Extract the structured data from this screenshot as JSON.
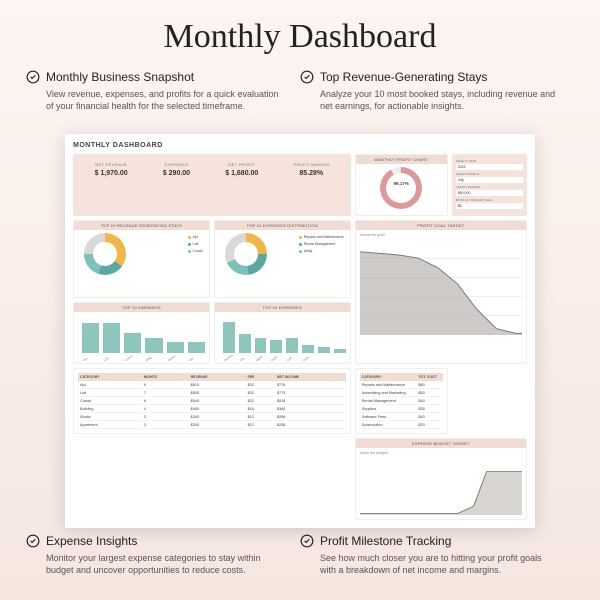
{
  "page_title": "Monthly Dashboard",
  "features_top": [
    {
      "title": "Monthly Business Snapshot",
      "desc": "View revenue, expenses, and profits for a quick evaluation of your financial health for the selected timeframe."
    },
    {
      "title": "Top Revenue-Generating Stays",
      "desc": "Analyze your 10 most booked stays, including revenue and net earnings, for actionable insights."
    }
  ],
  "features_bottom": [
    {
      "title": "Expense Insights",
      "desc": "Monitor your largest expense categories to stay within budget and uncover opportunities to reduce costs."
    },
    {
      "title": "Profit Milestone Tracking",
      "desc": "See how much closer you are to hitting your profit goals with a breakdown of net income and margins."
    }
  ],
  "dash": {
    "title": "MONTHLY DASHBOARD",
    "kpis": [
      {
        "label": "NET REVENUE",
        "value": "$ 1,970.00"
      },
      {
        "label": "EXPENSES",
        "value": "$ 290.00"
      },
      {
        "label": "NET PROFIT",
        "value": "$ 1,680.00"
      },
      {
        "label": "PROFIT MARGIN",
        "value": "85.28%"
      }
    ],
    "gross_profit_header": "MONTHLY PROFIT CHART",
    "gross_profit_value": "99.17%",
    "selectors": [
      {
        "label": "SELECT YEAR",
        "value": "2023"
      },
      {
        "label": "SELECT MONTH",
        "value": "July"
      },
      {
        "label": "YEARLY BUDGET",
        "value": "$50,000"
      },
      {
        "label": "MONTHLY BUDGET GOAL",
        "value": "$5"
      }
    ],
    "donutA_header": "TOP 10 REVENUE GENERATING STAYS",
    "donutA_legend": [
      "Apt",
      "Loft",
      "Condo"
    ],
    "donutB_header": "TOP 10 EXPENSES DISTRIBUTION",
    "donutB_legend": [
      "Repairs and Maintenance",
      "Rental Management",
      "Utility"
    ],
    "barsA_header": "TOP 10 EARNINGS",
    "barsB_header": "TOP 10 EXPENSES",
    "goal_header": "PROFIT GOAL TARGET",
    "goal_sub": "Almost the goal!",
    "budget_header": "EXPENSE BUDGET TARGET",
    "budget_sub": "Under the budget!",
    "table_headers": [
      "CATEGORY",
      "NIGHTS",
      "REVENUE",
      "FEE",
      "NET INCOME"
    ],
    "table_rows": [
      [
        "Apt",
        "9",
        "$810",
        "$32",
        "$778"
      ],
      [
        "Loft",
        "7",
        "$805",
        "$32",
        "$773"
      ],
      [
        "Condo",
        "6",
        "$540",
        "$22",
        "$518"
      ],
      [
        "Building",
        "4",
        "$400",
        "$16",
        "$384"
      ],
      [
        "Studio",
        "3",
        "$300",
        "$12",
        "$288"
      ],
      [
        "Apartment",
        "3",
        "$300",
        "$12",
        "$288"
      ]
    ],
    "table2_headers": [
      "CATEGORY",
      "TOT. COST"
    ],
    "table2_rows": [
      [
        "Repairs and Maintenance",
        "$80"
      ],
      [
        "Advertising and Marketing",
        "$50"
      ],
      [
        "Rental Management",
        "$40"
      ],
      [
        "Supplies",
        "$35"
      ],
      [
        "Software Fees",
        "$40"
      ],
      [
        "Subscription",
        "$20"
      ]
    ]
  },
  "chart_data": [
    {
      "type": "pie",
      "title": "TOP 10 REVENUE GENERATING STAYS",
      "categories": [
        "Apt",
        "Loft",
        "Condo",
        "Other"
      ],
      "values": [
        35,
        20,
        20,
        25
      ]
    },
    {
      "type": "pie",
      "title": "TOP 10 EXPENSES DISTRIBUTION",
      "categories": [
        "Repairs and Maintenance",
        "Rental Management",
        "Utility",
        "Other"
      ],
      "values": [
        25,
        23,
        20,
        32
      ]
    },
    {
      "type": "bar",
      "title": "TOP 10 EARNINGS",
      "categories": [
        "Apt",
        "Loft",
        "Condo",
        "Building",
        "Studio",
        "Apartment"
      ],
      "values": [
        810,
        805,
        540,
        400,
        300,
        300
      ],
      "ylim": [
        0,
        900
      ]
    },
    {
      "type": "bar",
      "title": "TOP 10 EXPENSES",
      "categories": [
        "Repairs",
        "Advertising",
        "Rental Mgmt",
        "Supplies",
        "Software",
        "Subscription",
        "Other",
        "Other"
      ],
      "values": [
        80,
        50,
        40,
        35,
        40,
        20,
        15,
        10
      ],
      "ylim": [
        0,
        90
      ]
    },
    {
      "type": "area",
      "title": "PROFIT GOAL TARGET",
      "x": [
        1,
        2,
        3,
        4,
        5,
        6,
        7,
        8,
        9,
        10,
        11,
        12
      ],
      "values": [
        2000,
        1950,
        1900,
        1850,
        1700,
        1500,
        1200,
        900,
        400,
        100,
        50,
        20
      ],
      "ylim": [
        0,
        2200
      ]
    },
    {
      "type": "area",
      "title": "EXPENSE BUDGET TARGET",
      "x": [
        1,
        2,
        3,
        4,
        5,
        6,
        7,
        8,
        9,
        10,
        11,
        12
      ],
      "values": [
        5,
        5,
        5,
        5,
        5,
        5,
        5,
        5,
        40,
        290,
        290,
        290
      ],
      "ylim": [
        0,
        320
      ]
    },
    {
      "type": "pie",
      "title": "MONTHLY PROFIT CHART",
      "categories": [
        "profit",
        "remainder"
      ],
      "values": [
        99.17,
        0.83
      ]
    }
  ]
}
